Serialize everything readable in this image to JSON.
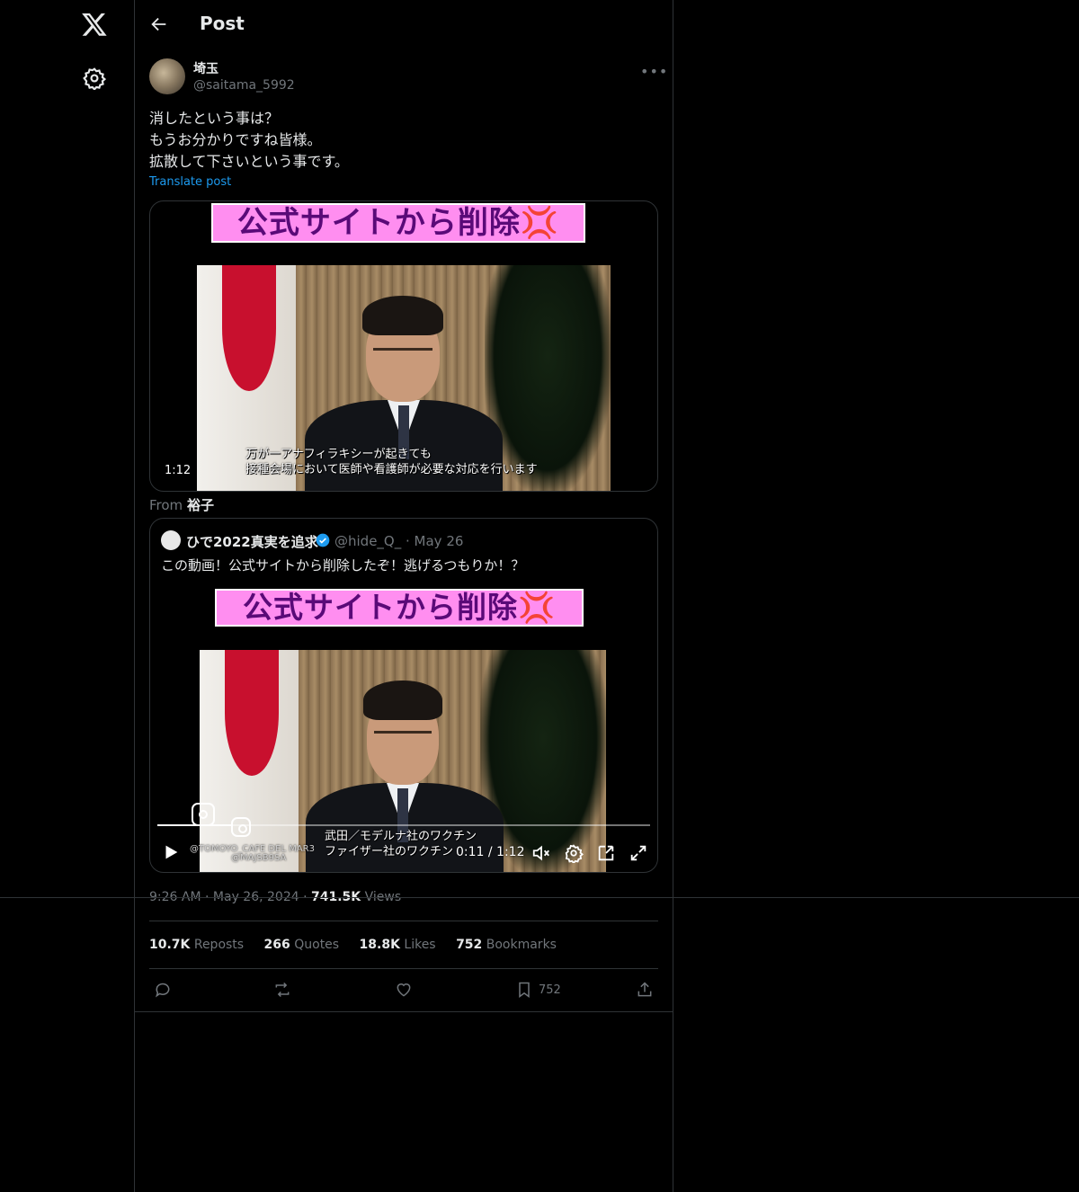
{
  "header": {
    "title": "Post"
  },
  "author": {
    "name": "埼玉",
    "handle": "@saitama_5992"
  },
  "post": {
    "text": "消したという事は？\nもうお分かりですね皆様。\n拡散して下さいという事です。",
    "translate_label": "Translate post"
  },
  "media1": {
    "banner": "公式サイトから削除💢",
    "subtitle": "万が一アナフィラキシーが起きても\n接種会場において医師や看護師が必要な対応を行います",
    "duration": "1:12"
  },
  "from": {
    "label": "From",
    "name": "裕子"
  },
  "quote": {
    "name": "ひで2022真実を追求",
    "handle": "@hide_Q_",
    "date": "May 26",
    "text": "この動画！公式サイトから削除したぞ！逃げるつもりか！？",
    "banner": "公式サイトから削除💢",
    "subtitle": "武田／モデルナ社のワクチン\nファイザー社のワクチン",
    "watermark1": "@TOMOYO_CAFE DEL MAR3",
    "watermark2": "@MAJSB9SA",
    "time": "0:11 / 1:12",
    "progress": 0.153
  },
  "meta": {
    "time": "9:26 AM",
    "date": "May 26, 2024",
    "views": "741.5K",
    "views_label": "Views"
  },
  "stats": {
    "reposts": "10.7K",
    "reposts_label": "Reposts",
    "quotes": "266",
    "quotes_label": "Quotes",
    "likes": "18.8K",
    "likes_label": "Likes",
    "bookmarks": "752",
    "bookmarks_label": "Bookmarks"
  },
  "actions": {
    "bookmark_count": "752"
  },
  "colors": {
    "accent": "#1d9bf0",
    "muted": "#71767b",
    "border": "#2f3336",
    "banner": "#ff8ef0"
  }
}
